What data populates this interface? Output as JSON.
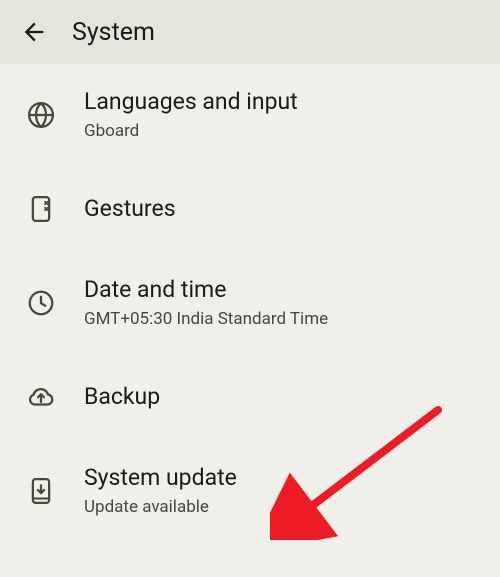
{
  "header": {
    "title": "System"
  },
  "items": [
    {
      "title": "Languages and input",
      "subtitle": "Gboard"
    },
    {
      "title": "Gestures",
      "subtitle": ""
    },
    {
      "title": "Date and time",
      "subtitle": "GMT+05:30 India Standard Time"
    },
    {
      "title": "Backup",
      "subtitle": ""
    },
    {
      "title": "System update",
      "subtitle": "Update available"
    }
  ],
  "colors": {
    "icon": "#45483d",
    "annotation": "#ed1c24"
  }
}
